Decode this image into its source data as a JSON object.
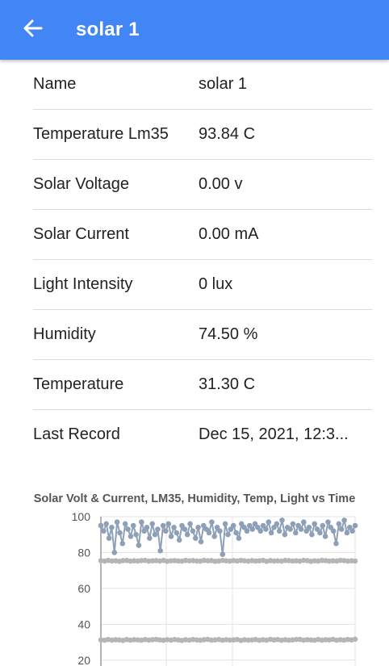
{
  "appbar": {
    "title": "solar 1",
    "back_icon": "arrow-left-icon",
    "color": "#4285f4"
  },
  "details": [
    {
      "label": "Name",
      "value": "solar 1"
    },
    {
      "label": "Temperature Lm35",
      "value": "93.84 C"
    },
    {
      "label": "Solar Voltage",
      "value": "0.00 v"
    },
    {
      "label": "Solar Current",
      "value": "0.00 mA"
    },
    {
      "label": "Light Intensity",
      "value": "0 lux"
    },
    {
      "label": "Humidity",
      "value": "74.50 %"
    },
    {
      "label": "Temperature",
      "value": "31.30 C"
    },
    {
      "label": "Last Record",
      "value": "Dec 15, 2021, 12:3..."
    }
  ],
  "chart_data": {
    "type": "scatter",
    "title": "Solar Volt & Current, LM35, Humidity, Temp, Light vs Time",
    "ylim": [
      10,
      100
    ],
    "yticks": [
      "100",
      "80",
      "60",
      "40",
      "20"
    ],
    "grid": true,
    "series": [
      {
        "color": "#8ea0b8",
        "values": [
          95,
          92,
          96,
          88,
          94,
          80,
          97,
          91,
          85,
          96,
          93,
          89,
          95,
          90,
          84,
          97,
          92,
          94,
          88,
          96,
          90,
          93,
          81,
          95,
          92,
          96,
          89,
          94,
          91,
          87,
          95,
          93,
          90,
          96,
          92,
          88,
          94,
          86,
          95,
          93,
          91,
          97,
          89,
          94,
          92,
          79,
          96,
          90,
          93,
          95,
          91,
          88,
          96,
          94,
          92,
          95,
          93,
          96,
          94,
          92,
          95,
          93,
          97,
          91,
          94,
          96,
          92,
          98,
          90,
          94,
          93,
          96,
          91,
          95,
          93,
          97,
          92,
          94,
          90,
          96,
          93,
          91,
          95,
          89,
          97,
          94,
          92,
          85,
          96,
          93,
          98,
          91,
          94,
          92,
          95
        ]
      },
      {
        "color": "#b5b5b5",
        "values": [
          75.5,
          75.2,
          75.6,
          75.3,
          75.4,
          75.1,
          75.5,
          75.6,
          75.2,
          75.4,
          75.3,
          75.5,
          75.6,
          75.2,
          75.4,
          75.5,
          75.3,
          75.6,
          75.1,
          75.4,
          75.5,
          75.3,
          75.2,
          75.6,
          75.4,
          75.5,
          75.3,
          75.2,
          75.6,
          75.4,
          75.5,
          75.1,
          75.3,
          75.6,
          75.4,
          75.2,
          75.5,
          75.3,
          75.6,
          75.4,
          75.2,
          75.5,
          75.3,
          75.4,
          75.6,
          75.1,
          75.5,
          75.3,
          75.4,
          75.2,
          75.6,
          75.5,
          75.3,
          75.4,
          75.2,
          75.6,
          75.5,
          75.1,
          75.4,
          75.3,
          75.6,
          75.5,
          75.2,
          75.4,
          75.3,
          75.6,
          75.5,
          75.2,
          75.4,
          75.3
        ]
      },
      {
        "color": "#b5b5b5",
        "values": [
          31.3,
          31.1,
          31.5,
          31.2,
          31.4,
          31.3,
          31.0,
          31.5,
          31.2,
          31.4,
          31.3,
          31.1,
          31.5,
          31.2,
          31.4,
          31.6,
          31.3,
          31.1,
          31.4,
          31.2,
          31.5,
          31.3,
          31.0,
          31.4,
          31.2,
          31.5,
          31.3,
          31.1,
          31.4,
          31.6,
          31.2,
          31.3,
          31.5,
          31.1,
          31.4,
          31.2,
          31.3,
          31.5,
          31.0,
          31.4,
          31.2,
          31.3,
          31.5,
          31.1,
          31.4,
          31.2,
          31.6,
          31.3,
          31.5,
          31.1,
          31.4,
          31.2,
          31.3,
          31.5,
          31.6,
          31.2,
          31.4,
          31.3,
          31.1,
          31.5,
          31.2,
          31.4,
          31.3,
          31.6,
          31.1,
          31.4,
          31.2,
          31.5,
          31.3,
          31.7
        ]
      }
    ]
  }
}
